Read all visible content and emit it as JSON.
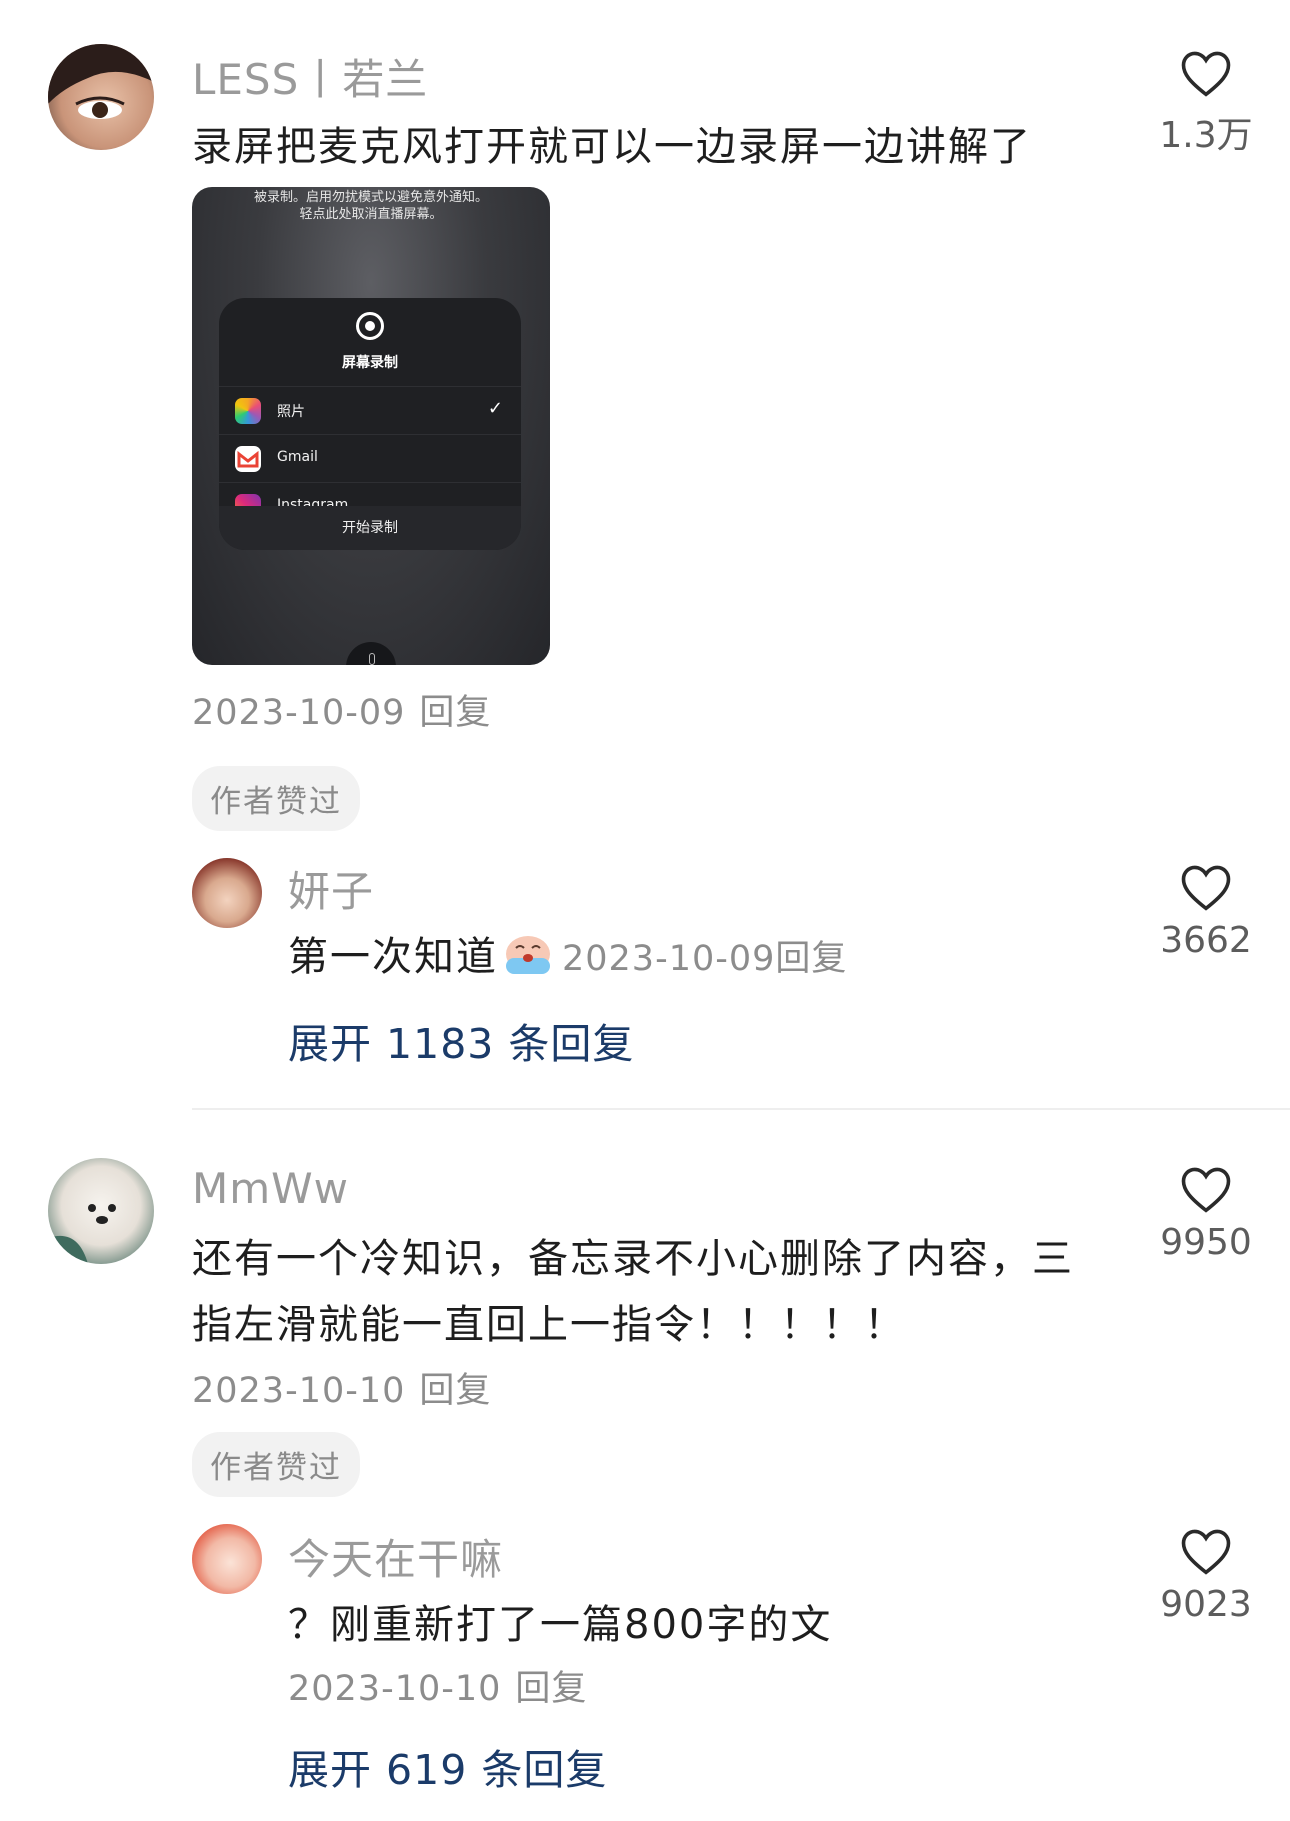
{
  "comments": [
    {
      "user": "LESS丨若兰",
      "text": "录屏把麦克风打开就可以一边录屏一边讲解了",
      "likes": "1.3万",
      "date": "2023-10-09",
      "reply_label": "回复",
      "author_liked": "作者赞过",
      "attachment": {
        "top_text_1": "被录制。启用勿扰模式以避免意外通知。",
        "top_text_2": "轻点此处取消直播屏幕。",
        "panel_title": "屏幕录制",
        "apps": [
          "照片",
          "Gmail",
          "Instagram"
        ],
        "checked_app": "照片",
        "start_button": "开始录制"
      },
      "reply": {
        "user": "妍子",
        "text": "第一次知道",
        "emoji": "crying-face-emoji",
        "date": "2023-10-09",
        "reply_label": "回复",
        "likes": "3662"
      },
      "expand": "展开 1183 条回复"
    },
    {
      "user": "MmWw",
      "text_line1": "还有一个冷知识，备忘录不小心删除了内容，三",
      "text_line2": "指左滑就能一直回上一指令！！！！！",
      "likes": "9950",
      "date": "2023-10-10",
      "reply_label": "回复",
      "author_liked": "作者赞过",
      "reply": {
        "user": "今天在干嘛",
        "text": "？刚重新打了一篇800字的文",
        "date": "2023-10-10",
        "reply_label": "回复",
        "likes": "9023"
      },
      "expand": "展开 619 条回复"
    }
  ],
  "colors": {
    "name": "#9a9a9a",
    "text": "#1e1e1e",
    "meta": "#8c8c8c",
    "expand_link": "#1b3b69",
    "badge_bg": "#f2f2f2"
  }
}
